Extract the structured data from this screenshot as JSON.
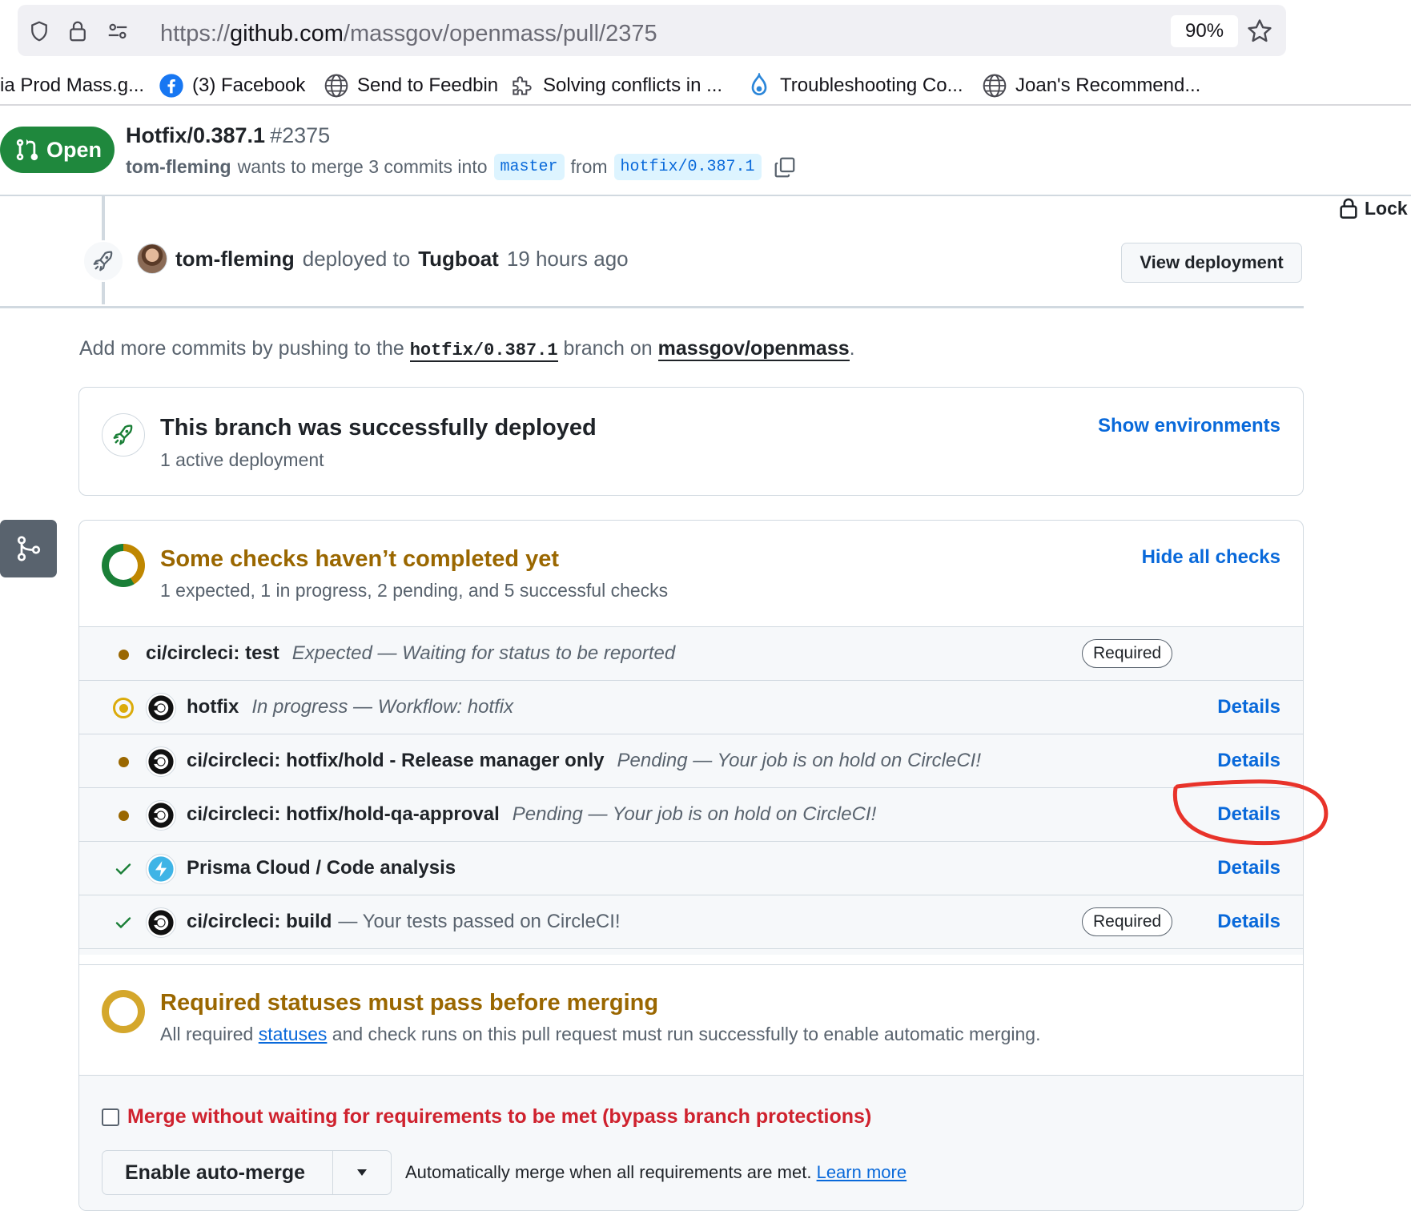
{
  "browser": {
    "url_scheme": "https://",
    "url_host": "github.com",
    "url_path": "/massgov/openmass/pull/2375",
    "zoom": "90%"
  },
  "bookmarks": [
    {
      "label": "ia Prod Mass.g...",
      "icon": "none"
    },
    {
      "label": "(3) Facebook",
      "icon": "facebook-icon"
    },
    {
      "label": "Send to Feedbin",
      "icon": "globe-icon"
    },
    {
      "label": "Solving conflicts in ...",
      "icon": "puzzle-icon"
    },
    {
      "label": "Troubleshooting Co...",
      "icon": "drupal-icon"
    },
    {
      "label": "Joan's Recommend...",
      "icon": "globe-icon"
    }
  ],
  "pr": {
    "state": "Open",
    "title": "Hotfix/0.387.1",
    "number": "#2375",
    "author": "tom-fleming",
    "merge_text": "wants to merge 3 commits into",
    "base_branch": "master",
    "from_text": "from",
    "head_branch": "hotfix/0.387.1"
  },
  "sidebar": {
    "lock_label": "Lock"
  },
  "deploy_event": {
    "actor": "tom-fleming",
    "verb": "deployed to",
    "environment": "Tugboat",
    "time": "19 hours ago",
    "button": "View deployment"
  },
  "add_more": {
    "prefix": "Add more commits by pushing to the",
    "branch": "hotfix/0.387.1",
    "middle": "branch on",
    "repo": "massgov/openmass",
    "suffix": "."
  },
  "deployed_box": {
    "title": "This branch was successfully deployed",
    "subtitle": "1 active deployment",
    "link": "Show environments"
  },
  "checks": {
    "title": "Some checks haven’t completed yet",
    "summary": "1 expected, 1 in progress, 2 pending, and 5 successful checks",
    "hide_link": "Hide all checks",
    "items": [
      {
        "name": "ci/circleci: test",
        "description": "Expected — Waiting for status to be reported",
        "status": "expected",
        "required": "Required",
        "details": ""
      },
      {
        "name": "hotfix",
        "description": "In progress — Workflow: hotfix",
        "status": "in_progress",
        "required": "",
        "details": "Details"
      },
      {
        "name": "ci/circleci: hotfix/hold - Release manager only",
        "description": "Pending — Your job is on hold on CircleCI!",
        "status": "pending",
        "required": "",
        "details": "Details"
      },
      {
        "name": "ci/circleci: hotfix/hold-qa-approval",
        "description": "Pending — Your job is on hold on CircleCI!",
        "status": "pending",
        "required": "",
        "details": "Details"
      },
      {
        "name": "Prisma Cloud / Code analysis",
        "description": "",
        "status": "success",
        "required": "",
        "details": "Details"
      },
      {
        "name": "ci/circleci: build",
        "description": "— Your tests passed on CircleCI!",
        "status": "success",
        "required": "Required",
        "details": "Details"
      }
    ]
  },
  "required_statuses": {
    "title": "Required statuses must pass before merging",
    "prefix": "All required",
    "link": "statuses",
    "suffix": "and check runs on this pull request must run successfully to enable automatic merging."
  },
  "merge_actions": {
    "bypass_label": "Merge without waiting for requirements to be met (bypass branch protections)",
    "auto_merge_button": "Enable auto-merge",
    "auto_merge_note": "Automatically merge when all requirements are met.",
    "learn_more": "Learn more"
  },
  "colors": {
    "open_green": "#1f883d",
    "pending_yellow": "#9a6700",
    "link_blue": "#0969da",
    "danger_red": "#cf222e",
    "annotation_red": "#e8332a"
  }
}
